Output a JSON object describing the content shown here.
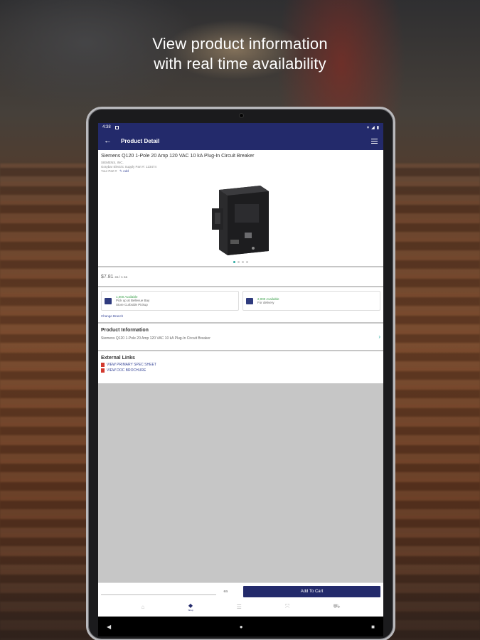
{
  "headline": {
    "line1": "View product information",
    "line2": "with real time availability"
  },
  "statusbar": {
    "time": "4:38"
  },
  "appbar": {
    "title": "Product Detail"
  },
  "product": {
    "name": "Siemens Q120 1-Pole 20 Amp 120 VAC 10 kA Plug-In Circuit Breaker",
    "brand": "SIEMENS, INC.",
    "part": "Graybar Electric Supply Part #: 123474",
    "your_part": "Your Part #",
    "add_label": "Add"
  },
  "price": {
    "value": "$7.81",
    "unit": "ea / 1 ea"
  },
  "availability": {
    "pickup_count": "1,000 Available",
    "pickup_line1": "Pick up at Bellevue Bay",
    "pickup_line2": "Store Curbside Pickup",
    "delivery_count": "2,000 Available",
    "delivery_line1": "For delivery",
    "change_branch": "Change Branch"
  },
  "product_info": {
    "heading": "Product Information",
    "description": "Siemens Q120 1-Pole 20 Amp 120 VAC 10 kA Plug-In Circuit Breaker"
  },
  "external_links": {
    "heading": "External Links",
    "items": [
      "VIEW PRIMARY SPEC SHEET",
      "VIEW DOC BROCHURE"
    ]
  },
  "cart": {
    "qty_unit": "ea",
    "button_label": "Add To Cart"
  },
  "tabs": [
    {
      "icon": "home-icon",
      "label": ""
    },
    {
      "icon": "tag-icon",
      "label": "Shop"
    },
    {
      "icon": "list-icon",
      "label": ""
    },
    {
      "icon": "scan-icon",
      "label": ""
    },
    {
      "icon": "cart-icon",
      "label": ""
    }
  ],
  "colors": {
    "primary": "#232a6b",
    "available": "#3aa04a",
    "accent": "#2aa8a0",
    "pdf": "#d23a2f"
  }
}
